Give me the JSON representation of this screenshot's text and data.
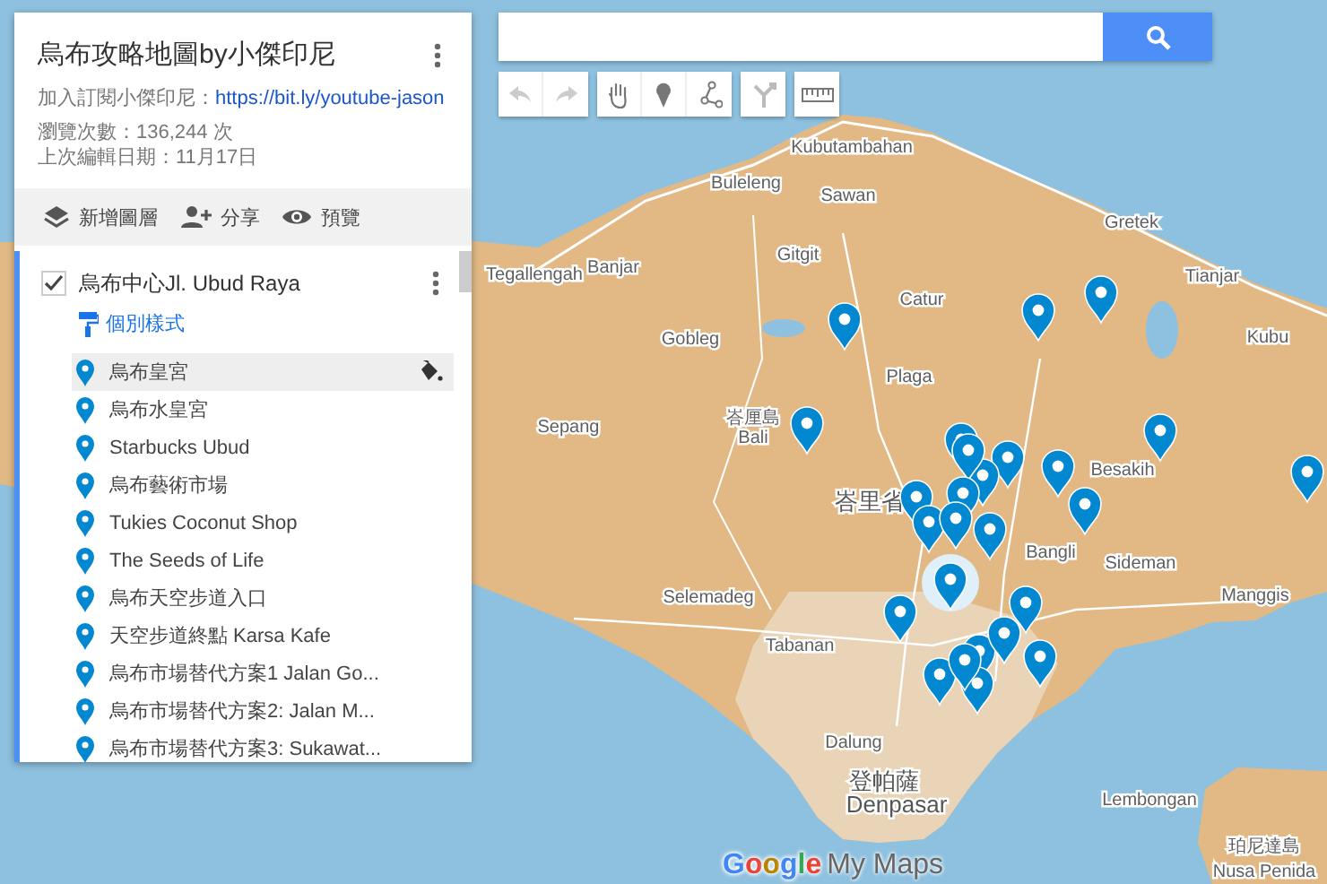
{
  "panel": {
    "title": "烏布攻略地圖by小傑印尼",
    "subscribe_label": "加入訂閱小傑印尼：",
    "subscribe_link": "https://bit.ly/youtube-jason",
    "views": "瀏覽次數：136,244 次",
    "last_edited": "上次編輯日期：11月17日",
    "actions": [
      {
        "kind": "layer",
        "label": "新增圖層"
      },
      {
        "kind": "share",
        "label": "分享"
      },
      {
        "kind": "preview",
        "label": "預覽"
      }
    ],
    "layer": {
      "name": "烏布中心Jl. Ubud Raya",
      "checked": true,
      "style_link": "個別樣式",
      "places": [
        {
          "label": "烏布皇宮",
          "selected": true
        },
        {
          "label": "烏布水皇宮",
          "selected": false
        },
        {
          "label": "Starbucks Ubud",
          "selected": false
        },
        {
          "label": "烏布藝術市場",
          "selected": false
        },
        {
          "label": "Tukies Coconut Shop",
          "selected": false
        },
        {
          "label": "The Seeds of Life",
          "selected": false
        },
        {
          "label": "烏布天空步道入口",
          "selected": false
        },
        {
          "label": "天空步道終點 Karsa Kafe",
          "selected": false
        },
        {
          "label": "烏布市場替代方案1 Jalan Go...",
          "selected": false
        },
        {
          "label": "烏布市場替代方案2: Jalan M...",
          "selected": false
        },
        {
          "label": "烏布市場替代方案3: Sukawat...",
          "selected": false
        }
      ]
    }
  },
  "map": {
    "labels": [
      "Kubutambahan",
      "Buleleng",
      "Sawan",
      "Gretek",
      "Gitgit",
      "Tegallengah",
      "Banjar",
      "Catur",
      "Tianjar",
      "Gobleg",
      "Kubu",
      "Plaga",
      "Sepang",
      "峇厘島",
      "Bali",
      "Besakih",
      "峇里省",
      "Bangli",
      "Sideman",
      "Selemadeg",
      "Manggis",
      "Tabanan",
      "Dalung",
      "登帕薩",
      "Denpasar",
      "Lembongan",
      "珀尼達島",
      "Nusa Penida"
    ],
    "logo_brand": "Google",
    "logo_product": "My Maps"
  }
}
